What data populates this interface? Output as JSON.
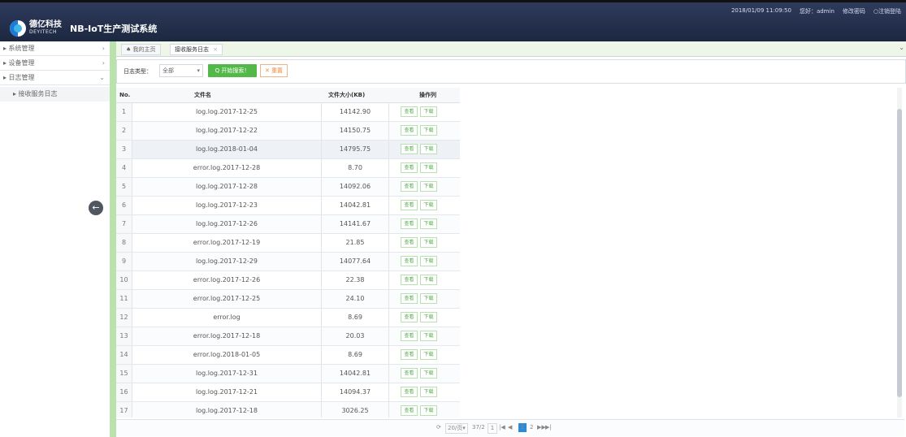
{
  "header": {
    "datetime": "2018/01/09 11:09:50",
    "greeting": "您好：admin",
    "change_password": "修改密码",
    "logout": "○注销登陆",
    "logo_cn": "德亿科技",
    "logo_en": "DEYITECH",
    "system_name": "NB-IoT生产测试系统"
  },
  "sidebar": {
    "items": [
      {
        "label": "▸ 系统管理",
        "arrow": "›"
      },
      {
        "label": "▸ 设备管理",
        "arrow": "›"
      },
      {
        "label": "▸ 日志管理",
        "arrow": "⌄"
      }
    ],
    "subitem": "▸ 接收服务日志",
    "collapse_icon": "←"
  },
  "tabs": {
    "home": "♠ 我的主页",
    "active": "接收服务日志",
    "close": "×",
    "scroll": "⌄"
  },
  "search": {
    "label": "日志类型：",
    "selected": "全部",
    "search_button": "Q 开始搜索！",
    "reset_button": "✕ 重置"
  },
  "table": {
    "headers": [
      "No.",
      "文件名",
      "文件大小(KB)",
      "操作列"
    ],
    "view_label": "查看",
    "download_label": "下载",
    "rows": [
      {
        "no": "1",
        "name": "log.log.2017-12-25",
        "size": "14142.90"
      },
      {
        "no": "2",
        "name": "log.log.2017-12-22",
        "size": "14150.75"
      },
      {
        "no": "3",
        "name": "log.log.2018-01-04",
        "size": "14795.75"
      },
      {
        "no": "4",
        "name": "error.log.2017-12-28",
        "size": "8.70"
      },
      {
        "no": "5",
        "name": "log.log.2017-12-28",
        "size": "14092.06"
      },
      {
        "no": "6",
        "name": "log.log.2017-12-23",
        "size": "14042.81"
      },
      {
        "no": "7",
        "name": "log.log.2017-12-26",
        "size": "14141.67"
      },
      {
        "no": "8",
        "name": "error.log.2017-12-19",
        "size": "21.85"
      },
      {
        "no": "9",
        "name": "log.log.2017-12-29",
        "size": "14077.64"
      },
      {
        "no": "10",
        "name": "error.log.2017-12-26",
        "size": "22.38"
      },
      {
        "no": "11",
        "name": "error.log.2017-12-25",
        "size": "24.10"
      },
      {
        "no": "12",
        "name": "error.log",
        "size": "8.69"
      },
      {
        "no": "13",
        "name": "error.log.2017-12-18",
        "size": "20.03"
      },
      {
        "no": "14",
        "name": "error.log.2018-01-05",
        "size": "8.69"
      },
      {
        "no": "15",
        "name": "log.log.2017-12-31",
        "size": "14042.81"
      },
      {
        "no": "16",
        "name": "log.log.2017-12-21",
        "size": "14094.37"
      },
      {
        "no": "17",
        "name": "log.log.2017-12-18",
        "size": "3026.25"
      }
    ]
  },
  "pagination": {
    "refresh": "⟳",
    "page_size": "20/页▾",
    "page_info": "37/2",
    "current_input": "1",
    "first": "|◀",
    "prev": "◀",
    "page1": "1",
    "page2": "2",
    "next": "▶▶",
    "last": "▶|"
  }
}
